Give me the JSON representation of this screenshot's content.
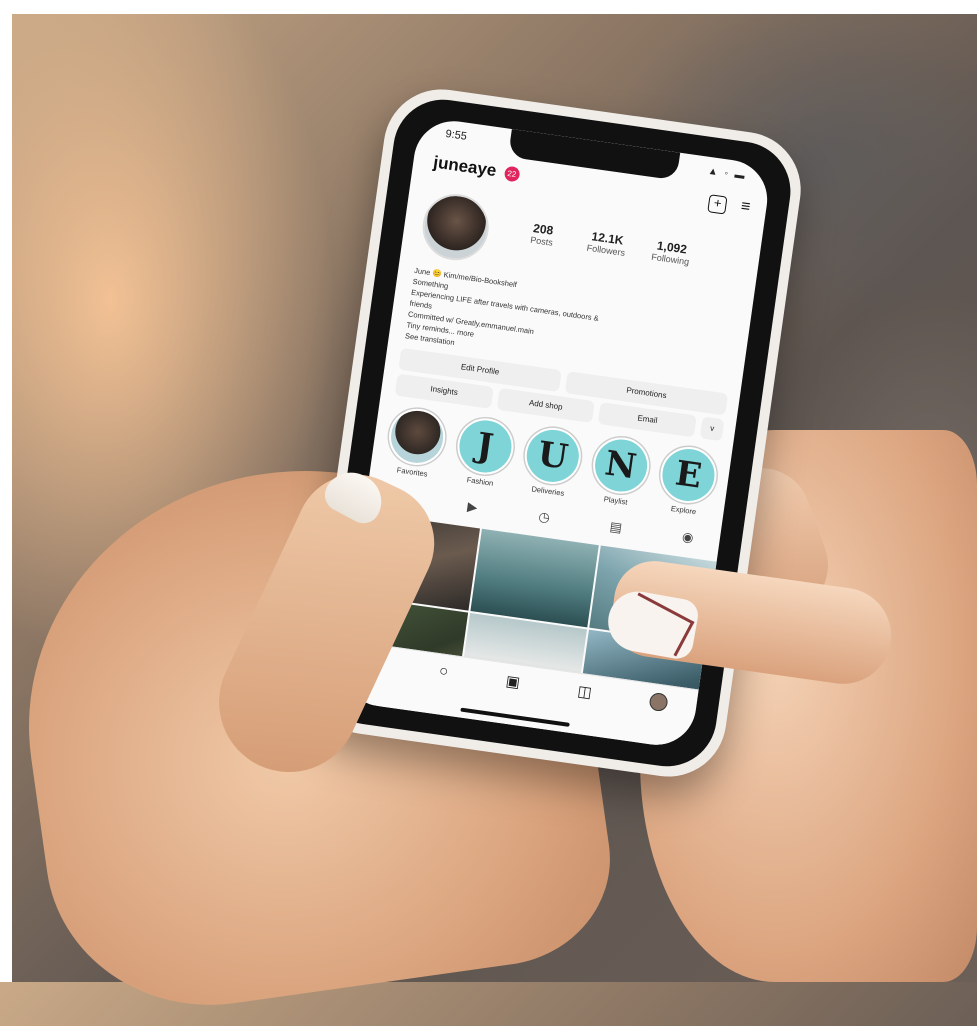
{
  "status": {
    "time": "9:55",
    "icons": "▲ ◦ ▬"
  },
  "header": {
    "username": "juneaye",
    "badge": "22"
  },
  "stats": [
    {
      "value": "208",
      "label": "Posts"
    },
    {
      "value": "12.1K",
      "label": "Followers"
    },
    {
      "value": "1,092",
      "label": "Following"
    }
  ],
  "bio": {
    "line1": "June 😊 Kim/me/Bio-Bookshelf",
    "line2": "Something",
    "line3": "Experiencing LIFE after travels with cameras, outdoors &",
    "line4": "friends",
    "line5": "Committed w/ Greatly.emmanuel.main",
    "line6": "Tiny reminds... more",
    "line7": "See translation"
  },
  "buttons": {
    "row1": [
      "Edit Profile",
      "Promotions"
    ],
    "row2": [
      "Insights",
      "Add shop",
      "Email",
      "v"
    ]
  },
  "highlights": [
    {
      "letter": "",
      "label": "Favorites"
    },
    {
      "letter": "J",
      "label": "Fashion"
    },
    {
      "letter": "U",
      "label": "Deliveries"
    },
    {
      "letter": "N",
      "label": "Playlist"
    },
    {
      "letter": "E",
      "label": "Explore"
    }
  ],
  "tabs": {
    "grid": "▦",
    "reels": "▶",
    "video": "◷",
    "guides": "▤",
    "tagged": "◉"
  },
  "nav": {
    "home": "⌂",
    "search": "○",
    "reels": "▣",
    "shop": "◫"
  }
}
